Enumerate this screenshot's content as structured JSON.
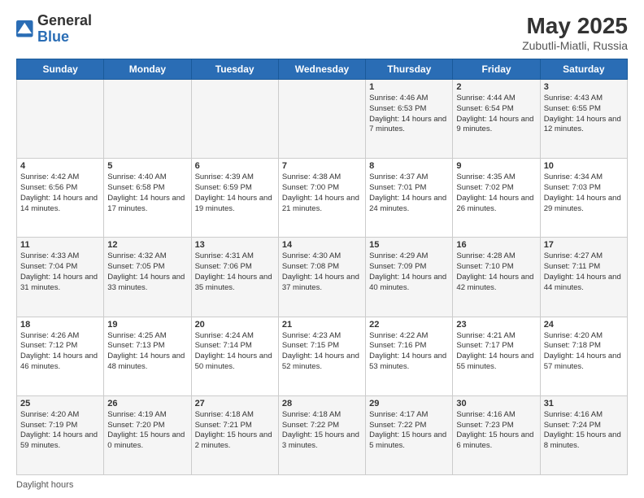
{
  "header": {
    "logo": {
      "general": "General",
      "blue": "Blue",
      "icon_title": "GeneralBlue logo"
    },
    "title": "May 2025",
    "location": "Zubutli-Miatli, Russia"
  },
  "calendar": {
    "weekdays": [
      "Sunday",
      "Monday",
      "Tuesday",
      "Wednesday",
      "Thursday",
      "Friday",
      "Saturday"
    ],
    "weeks": [
      [
        {
          "day": "",
          "info": ""
        },
        {
          "day": "",
          "info": ""
        },
        {
          "day": "",
          "info": ""
        },
        {
          "day": "",
          "info": ""
        },
        {
          "day": "1",
          "info": "Sunrise: 4:46 AM\nSunset: 6:53 PM\nDaylight: 14 hours and 7 minutes."
        },
        {
          "day": "2",
          "info": "Sunrise: 4:44 AM\nSunset: 6:54 PM\nDaylight: 14 hours and 9 minutes."
        },
        {
          "day": "3",
          "info": "Sunrise: 4:43 AM\nSunset: 6:55 PM\nDaylight: 14 hours and 12 minutes."
        }
      ],
      [
        {
          "day": "4",
          "info": "Sunrise: 4:42 AM\nSunset: 6:56 PM\nDaylight: 14 hours and 14 minutes."
        },
        {
          "day": "5",
          "info": "Sunrise: 4:40 AM\nSunset: 6:58 PM\nDaylight: 14 hours and 17 minutes."
        },
        {
          "day": "6",
          "info": "Sunrise: 4:39 AM\nSunset: 6:59 PM\nDaylight: 14 hours and 19 minutes."
        },
        {
          "day": "7",
          "info": "Sunrise: 4:38 AM\nSunset: 7:00 PM\nDaylight: 14 hours and 21 minutes."
        },
        {
          "day": "8",
          "info": "Sunrise: 4:37 AM\nSunset: 7:01 PM\nDaylight: 14 hours and 24 minutes."
        },
        {
          "day": "9",
          "info": "Sunrise: 4:35 AM\nSunset: 7:02 PM\nDaylight: 14 hours and 26 minutes."
        },
        {
          "day": "10",
          "info": "Sunrise: 4:34 AM\nSunset: 7:03 PM\nDaylight: 14 hours and 29 minutes."
        }
      ],
      [
        {
          "day": "11",
          "info": "Sunrise: 4:33 AM\nSunset: 7:04 PM\nDaylight: 14 hours and 31 minutes."
        },
        {
          "day": "12",
          "info": "Sunrise: 4:32 AM\nSunset: 7:05 PM\nDaylight: 14 hours and 33 minutes."
        },
        {
          "day": "13",
          "info": "Sunrise: 4:31 AM\nSunset: 7:06 PM\nDaylight: 14 hours and 35 minutes."
        },
        {
          "day": "14",
          "info": "Sunrise: 4:30 AM\nSunset: 7:08 PM\nDaylight: 14 hours and 37 minutes."
        },
        {
          "day": "15",
          "info": "Sunrise: 4:29 AM\nSunset: 7:09 PM\nDaylight: 14 hours and 40 minutes."
        },
        {
          "day": "16",
          "info": "Sunrise: 4:28 AM\nSunset: 7:10 PM\nDaylight: 14 hours and 42 minutes."
        },
        {
          "day": "17",
          "info": "Sunrise: 4:27 AM\nSunset: 7:11 PM\nDaylight: 14 hours and 44 minutes."
        }
      ],
      [
        {
          "day": "18",
          "info": "Sunrise: 4:26 AM\nSunset: 7:12 PM\nDaylight: 14 hours and 46 minutes."
        },
        {
          "day": "19",
          "info": "Sunrise: 4:25 AM\nSunset: 7:13 PM\nDaylight: 14 hours and 48 minutes."
        },
        {
          "day": "20",
          "info": "Sunrise: 4:24 AM\nSunset: 7:14 PM\nDaylight: 14 hours and 50 minutes."
        },
        {
          "day": "21",
          "info": "Sunrise: 4:23 AM\nSunset: 7:15 PM\nDaylight: 14 hours and 52 minutes."
        },
        {
          "day": "22",
          "info": "Sunrise: 4:22 AM\nSunset: 7:16 PM\nDaylight: 14 hours and 53 minutes."
        },
        {
          "day": "23",
          "info": "Sunrise: 4:21 AM\nSunset: 7:17 PM\nDaylight: 14 hours and 55 minutes."
        },
        {
          "day": "24",
          "info": "Sunrise: 4:20 AM\nSunset: 7:18 PM\nDaylight: 14 hours and 57 minutes."
        }
      ],
      [
        {
          "day": "25",
          "info": "Sunrise: 4:20 AM\nSunset: 7:19 PM\nDaylight: 14 hours and 59 minutes."
        },
        {
          "day": "26",
          "info": "Sunrise: 4:19 AM\nSunset: 7:20 PM\nDaylight: 15 hours and 0 minutes."
        },
        {
          "day": "27",
          "info": "Sunrise: 4:18 AM\nSunset: 7:21 PM\nDaylight: 15 hours and 2 minutes."
        },
        {
          "day": "28",
          "info": "Sunrise: 4:18 AM\nSunset: 7:22 PM\nDaylight: 15 hours and 3 minutes."
        },
        {
          "day": "29",
          "info": "Sunrise: 4:17 AM\nSunset: 7:22 PM\nDaylight: 15 hours and 5 minutes."
        },
        {
          "day": "30",
          "info": "Sunrise: 4:16 AM\nSunset: 7:23 PM\nDaylight: 15 hours and 6 minutes."
        },
        {
          "day": "31",
          "info": "Sunrise: 4:16 AM\nSunset: 7:24 PM\nDaylight: 15 hours and 8 minutes."
        }
      ]
    ]
  },
  "legend": {
    "daylight_hours": "Daylight hours"
  }
}
